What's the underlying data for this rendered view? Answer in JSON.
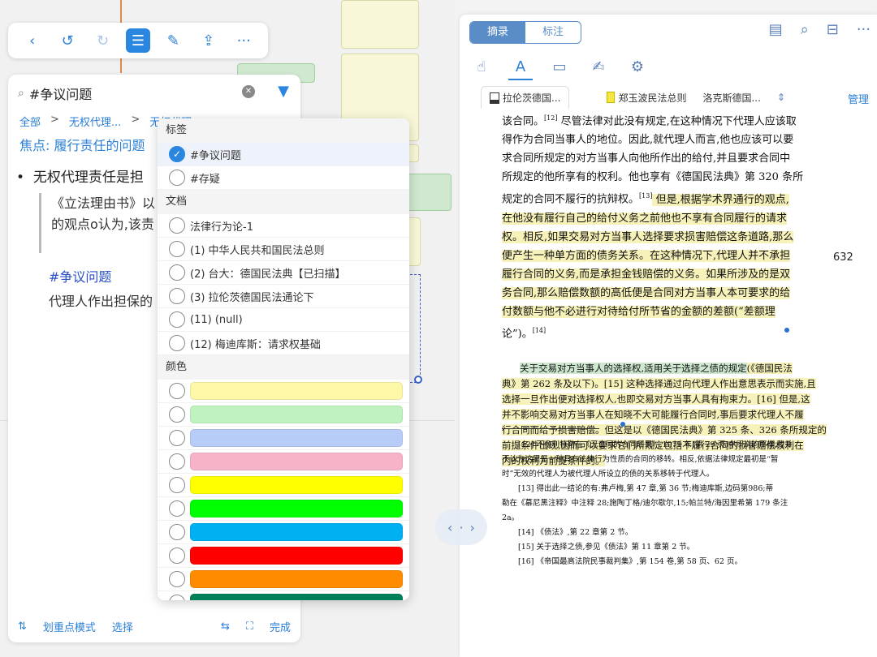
{
  "toolbar": {
    "icons": [
      "back-icon",
      "undo-icon",
      "redo-icon",
      "outline-icon",
      "edit-icon",
      "share-icon",
      "more-icon"
    ]
  },
  "left_panel": {
    "search_value": "#争议问题",
    "breadcrumb": [
      "全部",
      ">",
      "无权代理...",
      ">",
      "无权代理..."
    ],
    "focus": "焦点:  履行责任的问题",
    "bullet": "无权代理责任是担",
    "quote_line1": "《立法理由书》以",
    "quote_line2": "的观点o认为,该责",
    "hashtag": "#争议问题",
    "agent_line": "代理人作出担保的",
    "bottom": {
      "highlight_mode": "划重点模式",
      "select": "选择",
      "done": "完成"
    }
  },
  "dropdown": {
    "section_tags": "标签",
    "tags": [
      {
        "label": "#争议问题",
        "checked": true
      },
      {
        "label": "#存疑",
        "checked": false
      }
    ],
    "section_docs": "文档",
    "docs": [
      "法律行为论-1",
      "(1) 中华人民共和国民法总则",
      "(2) 台大：德国民法典【已扫描】",
      "(3) 拉伦茨德国民法通论下",
      "(11) (null)",
      "(12) 梅迪库斯：请求权基础"
    ],
    "section_colors": "颜色",
    "colors": [
      "#fdf7a8",
      "#bff2bf",
      "#b7cdf7",
      "#f7b4c8",
      "#ffff00",
      "#00ff00",
      "#00b0f0",
      "#ff0000",
      "#ff8c00",
      "#00805a"
    ]
  },
  "reader": {
    "seg_left": "摘录",
    "seg_right": "标注",
    "tabs": [
      {
        "label": "拉伦茨德国..."
      },
      {
        "label": "郑玉波民法总则"
      },
      {
        "label": "洛克斯德国..."
      }
    ],
    "manage": "管理",
    "page_number": "632",
    "body": [
      {
        "text": "该合同。",
        "sup": "[12]",
        "text2": " 尽管法律对此没有规定,在这种情况下代理人应该取",
        "hl": false
      },
      {
        "text": "得作为合同当事人的地位。因此,就代理人而言,他也应该可以要",
        "hl": false
      },
      {
        "text": "求合同所规定的对方当事人向他所作出的给付,并且要求合同中",
        "hl": false
      },
      {
        "text": "所规定的他所享有的权利。他也享有《德国民法典》第 320 条所",
        "hl": false
      },
      {
        "text": "规定的合同不履行的抗辩权。",
        "sup": "[13]",
        "text2": " 但是,根据学术界通行的观点,",
        "hl": "partial"
      },
      {
        "text": "在他没有履行自己的给付义务之前他也不享有合同履行的请求",
        "hl": true
      },
      {
        "text": "权。相反,如果交易对方当事人选择要求损害赔偿这条道路,那么",
        "hl": true
      },
      {
        "text": "便产生一种单方面的债务关系。在这种情况下,代理人并不承担",
        "hl": true
      },
      {
        "text": "履行合同的义务,而是承担金钱赔偿的义务。如果所涉及的是双",
        "hl": true
      },
      {
        "text": "务合同,那么赔偿数额的高低便是合同对方当事人本可要求的给",
        "hl": true
      },
      {
        "text": "付数额与他不必进行对待给付所节省的金额的差额(“差额理",
        "hl": true
      },
      {
        "text": "论”)。",
        "sup": "[14]",
        "text2": "",
        "hl": false
      }
    ],
    "para2": [
      {
        "g": "关于交易对方当事人的选择权,适用关于选择之债的规定",
        "y": "(《德国民法"
      },
      {
        "y": "典》第 262 条及以下)。[15] 这种选择通过向代理人作出意思表示而实施,且"
      },
      {
        "y": "选择一旦作出便对选择权人,也即交易对方当事人具有拘束力。[16] 但是,这"
      },
      {
        "y": "并不影响交易对方当事人在知晓不大可能履行合同时,事后要求代理人不履"
      },
      {
        "y": "行合同而给予损害赔偿。但这是以《德国民法典》第 325 条、326 条所规定的"
      },
      {
        "y": "前提条件出现,因而可以要求它们所规定包括不履行合同的损害赔偿权利在"
      },
      {
        "y": "内的权利为前提条件的。"
      }
    ],
    "footnotes": [
      "[12]   不像利特勒在《无合同的合同后果》,1979 年(第 29 页)中所说的那样,我并",
      "不认为这里是一种具有法律行为性质的合同的移转。相反,依据法律规定最初是“暂",
      "时”无效的代理人为被代理人所设立的债的关系移转于代理人。",
      "[13]   得出此一结论的有:弗卢梅,第 47 章,第 36 节;梅迪库斯,边码第986;蒂",
      "勒在《慕尼黑注释》中注释 28;施陶丁格/迪尔歇尔,15;帕兰特/海因里希第 179 条注",
      "2a。",
      "[14]   《债法》,第 22 章第 2 节。",
      "[15]   关于选择之债,参见《债法》第 11 章第 2 节。",
      "[16]   《帝国最高法院民事裁判集》,第 154 卷,第 58 页、62 页。"
    ]
  }
}
